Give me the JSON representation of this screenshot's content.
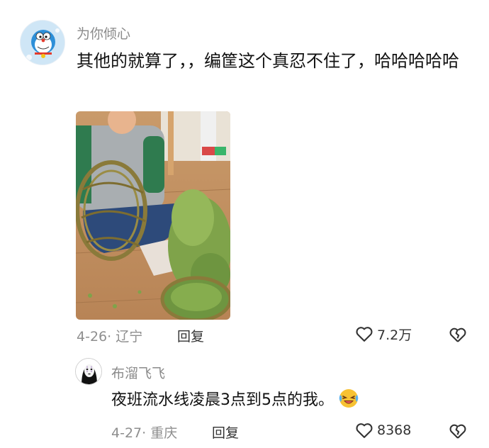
{
  "comment": {
    "username": "为你倾心",
    "text": "其他的就算了，，编筐这个真忍不住了，哈哈哈哈哈",
    "date_location": "4-26· 辽宁",
    "reply_label": "回复",
    "likes": "7.2万",
    "avatar_icon": "doraemon-avatar",
    "image_icon": "child-weaving-willow-basket-photo"
  },
  "reply": {
    "username": "布溜飞飞",
    "text": "夜班流水线凌晨3点到5点的我。",
    "emoji": "laughing-crying-emoji",
    "date_location": "4-27· 重庆",
    "reply_label": "回复",
    "likes": "8368",
    "avatar_icon": "no-face-avatar"
  },
  "colors": {
    "username": "#8a8a8a",
    "text": "#111111",
    "meta": "#8e8e8e"
  }
}
